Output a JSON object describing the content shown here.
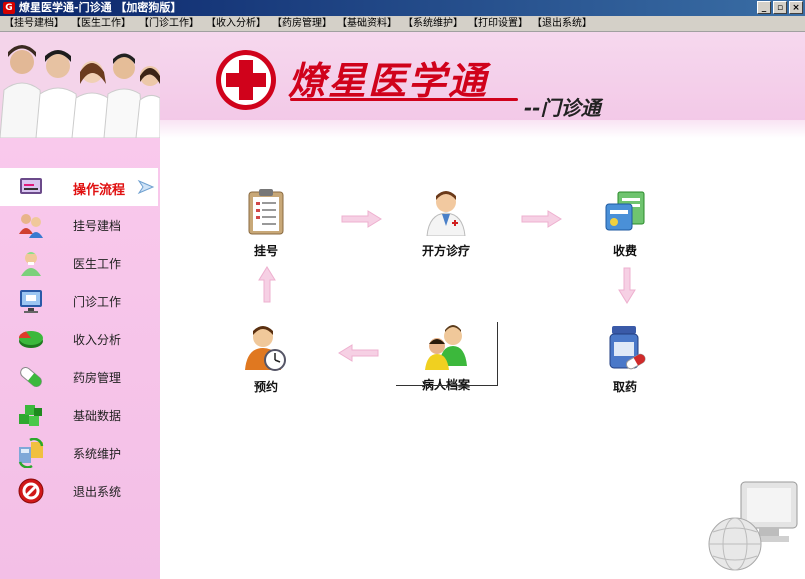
{
  "window": {
    "title": "燎星医学通-门诊通 【加密狗版】",
    "controls": [
      "_",
      "▫",
      "×"
    ]
  },
  "menu": [
    "【挂号建档】",
    "【医生工作】",
    "【门诊工作】",
    "【收入分析】",
    "【药房管理】",
    "【基础资料】",
    "【系统维护】",
    "【打印设置】",
    "【退出系统】"
  ],
  "banner": {
    "brand": "燎星医学通",
    "subtitle": "--门诊通"
  },
  "sidebar": {
    "items": [
      {
        "label": "操作流程",
        "icon": "workflow-icon",
        "active": true
      },
      {
        "label": "挂号建档",
        "icon": "patients-icon",
        "active": false
      },
      {
        "label": "医生工作",
        "icon": "doctor-icon",
        "active": false
      },
      {
        "label": "门诊工作",
        "icon": "monitor-icon",
        "active": false
      },
      {
        "label": "收入分析",
        "icon": "pie-chart-icon",
        "active": false
      },
      {
        "label": "药房管理",
        "icon": "pill-icon",
        "active": false
      },
      {
        "label": "基础数据",
        "icon": "cubes-icon",
        "active": false
      },
      {
        "label": "系统维护",
        "icon": "maintenance-icon",
        "active": false
      },
      {
        "label": "退出系统",
        "icon": "stop-icon",
        "active": false
      }
    ]
  },
  "workflow": {
    "register": "挂号",
    "diagnose": "开方诊疗",
    "charge": "收费",
    "dispense": "取药",
    "records": "病人档案",
    "appointment": "预约"
  },
  "colors": {
    "accent": "#e01010",
    "sidebar": "#f6c4e9",
    "banner": "#f4cdea",
    "arrow": "#f3b8d8"
  }
}
